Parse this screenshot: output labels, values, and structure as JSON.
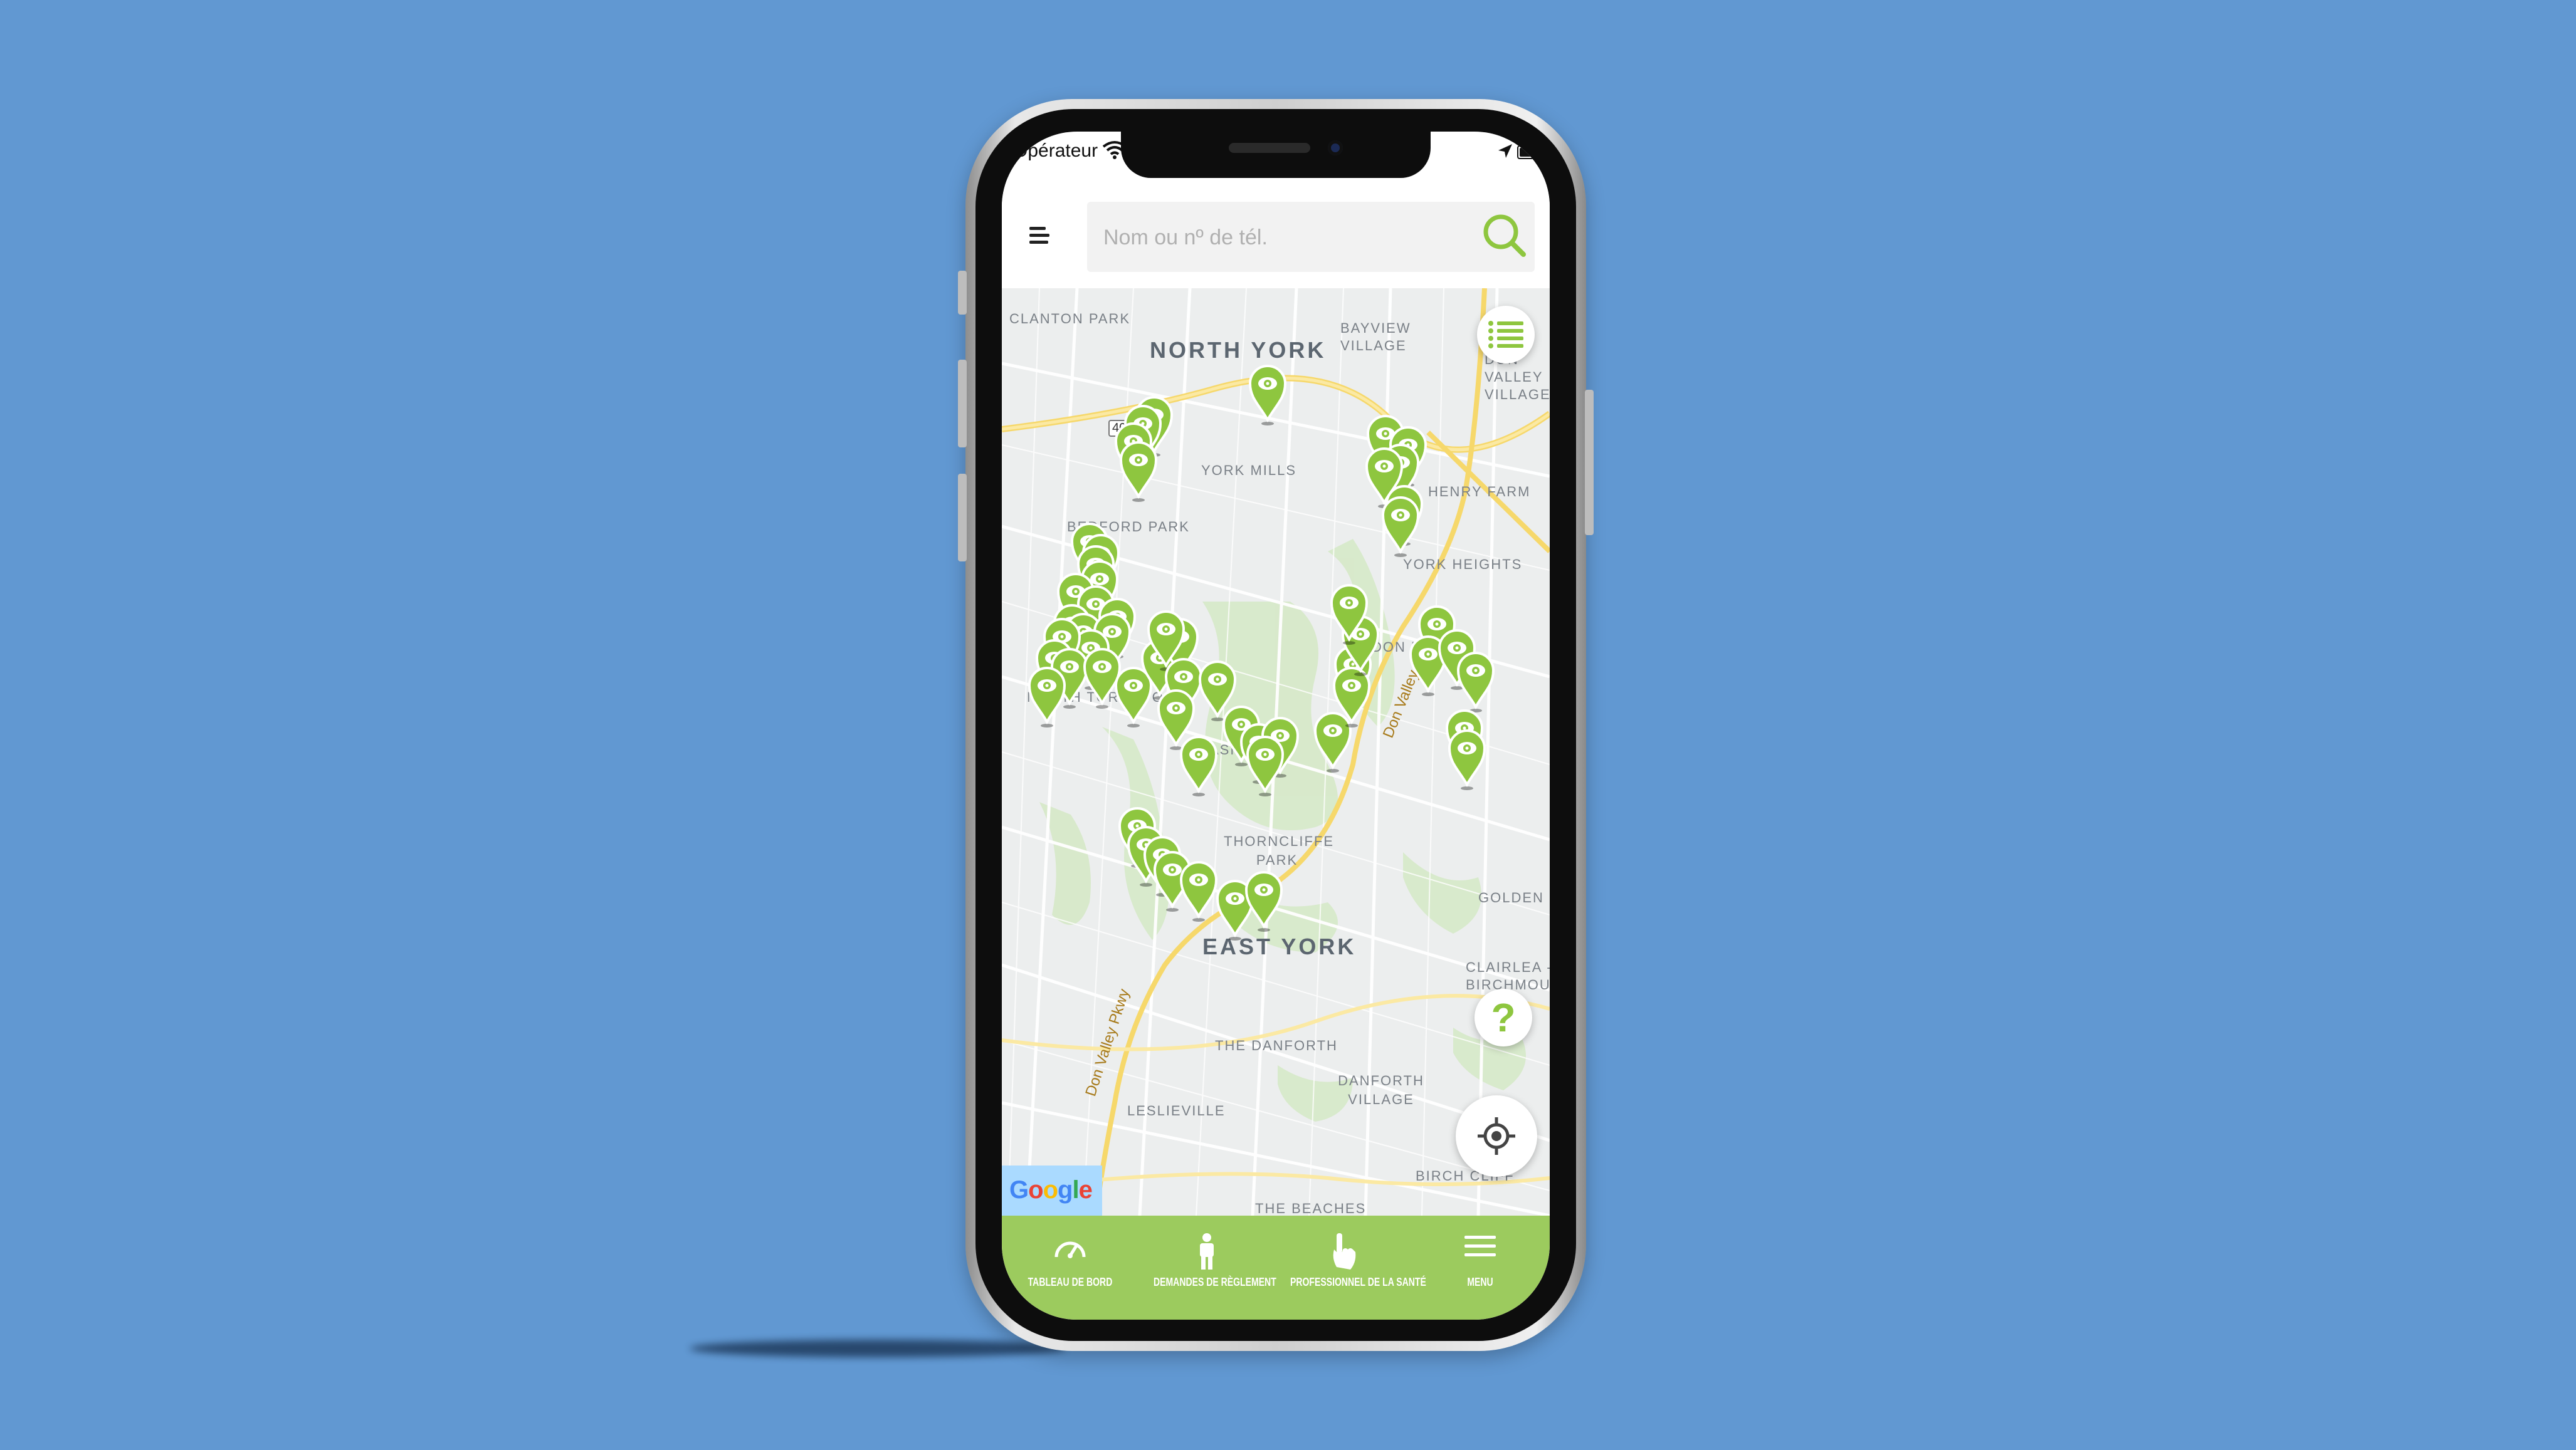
{
  "status_bar": {
    "carrier": "Opérateur"
  },
  "search": {
    "placeholder": "Nom ou nº de tél."
  },
  "map": {
    "labels": {
      "north_york": "NORTH YORK",
      "clanton_park": "CLANTON PARK",
      "bayview_village": "BAYVIEW VILLAGE",
      "don_valley_village": "DON VALLEY VILLAGE",
      "york_mills": "YORK MILLS",
      "bedford_park": "BEDFORD PARK",
      "henry_farm": "HENRY FARM",
      "york_heights": "YORK HEIGHTS",
      "don_mills": "DON MILLS",
      "north_toronto": "NORTH TORONTO",
      "leaside": "LEASIDE",
      "thorncliffe_park": "THORNCLIFFE PARK",
      "golden_mile": "GOLDEN MILE",
      "east_york": "EAST YORK",
      "clairlea": "CLAIRLEA - BIRCHMOUNT",
      "the_danforth": "THE DANFORTH",
      "danforth_village": "DANFORTH VILLAGE",
      "leslieville": "LESLIEVILLE",
      "birch_cliff": "BIRCH CLIFF",
      "the_beaches": "THE BEACHES",
      "hwy_401": "401",
      "hwy_404": "401",
      "don_valley_pkwy_1": "Don Valley Pkwy",
      "don_valley_pkwy_2": "Don Valley Pkwy"
    },
    "attribution": "Google",
    "pin_icon": "map-pin-eye-icon",
    "pin_count": 57
  },
  "fab": {
    "list_icon": "list-icon",
    "help_label": "?",
    "locate_icon": "crosshair-locate-icon"
  },
  "bottom_nav": {
    "items": [
      {
        "label": "TABLEAU DE BORD",
        "icon": "gauge-icon"
      },
      {
        "label": "DEMANDES DE RÈGLEMENT",
        "icon": "person-icon"
      },
      {
        "label": "PROFESSIONNEL DE LA SANTÉ",
        "icon": "hand-pointer-icon"
      },
      {
        "label": "MENU",
        "icon": "menu-icon"
      }
    ]
  },
  "colors": {
    "accent": "#9ccb5e",
    "pin": "#8ec63f",
    "background": "#6198d2"
  }
}
